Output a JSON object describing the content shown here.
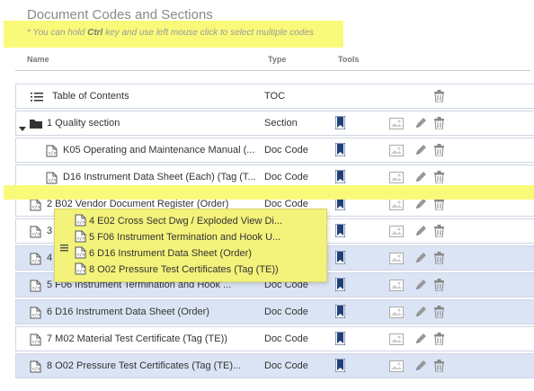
{
  "page": {
    "title": "Document Codes and Sections",
    "hint_prefix": "* You can hold ",
    "hint_key": "Ctrl",
    "hint_suffix": " key and use left mouse click to select multiple codes"
  },
  "columns": {
    "name": "Name",
    "type": "Type",
    "tools": "Tools"
  },
  "rows": [
    {
      "num": "",
      "label": "Table of Contents",
      "type": "TOC",
      "selected": false
    },
    {
      "num": "1",
      "label": "Quality section",
      "type": "Section",
      "selected": false
    },
    {
      "num": "",
      "label": "K05 Operating and Maintenance Manual (...",
      "type": "Doc Code",
      "selected": false
    },
    {
      "num": "",
      "label": "D16 Instrument Data Sheet (Each) (Tag (T...",
      "type": "Doc Code",
      "selected": false
    },
    {
      "num": "2",
      "label": "B02 Vendor Document Register (Order)",
      "type": "Doc Code",
      "selected": false
    },
    {
      "num": "3",
      "label": "O02 Pressure Test Certificates (Tag (TE))",
      "type": "Doc Code",
      "selected": false
    },
    {
      "num": "4",
      "label": "E02 Cross Sect Dwg / Exploded View Dims",
      "type": "Doc Code",
      "selected": true
    },
    {
      "num": "5",
      "label": "F06 Instrument Termination and Hook ...",
      "type": "Doc Code",
      "selected": true
    },
    {
      "num": "6",
      "label": "D16 Instrument Data Sheet (Order)",
      "type": "Doc Code",
      "selected": true
    },
    {
      "num": "7",
      "label": "M02 Material Test Certificate (Tag (TE))",
      "type": "Doc Code",
      "selected": false
    },
    {
      "num": "8",
      "label": "O02 Pressure Test Certificates (Tag (TE)...",
      "type": "Doc Code",
      "selected": true
    }
  ],
  "drag_items": [
    {
      "num": "4",
      "label": "E02 Cross Sect Dwg / Exploded View Di..."
    },
    {
      "num": "5",
      "label": "F06 Instrument Termination and Hook U..."
    },
    {
      "num": "6",
      "label": "D16 Instrument Data Sheet (Order)"
    },
    {
      "num": "8",
      "label": "O02 Pressure Test Certificates (Tag (TE))"
    }
  ],
  "colors": {
    "selected_row": "#dbe4f4",
    "highlight": "#fafa7a",
    "bookmark": "#1f3f7a"
  }
}
